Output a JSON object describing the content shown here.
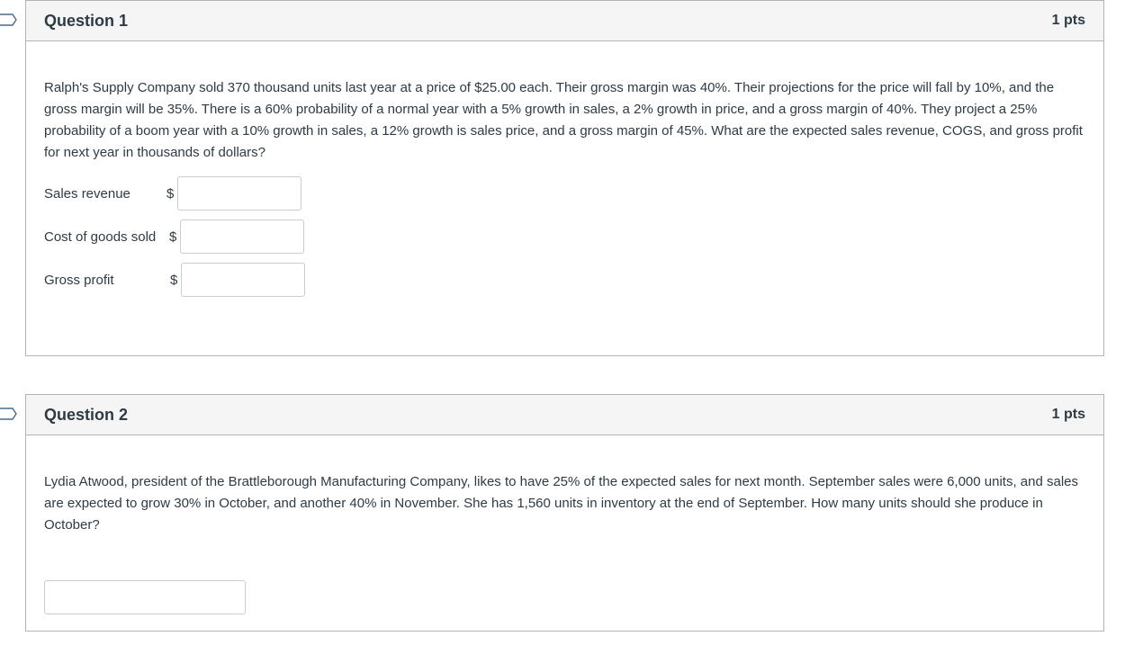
{
  "questions": [
    {
      "title": "Question 1",
      "points": "1 pts",
      "text": "Ralph's Supply Company sold 370 thousand units last year at a price of $25.00 each.  Their gross margin was 40%.  Their projections for the price will fall by 10%, and the gross margin will be 35%.  There is a 60% probability of a normal year with a 5% growth in sales, a 2% growth in price, and a gross margin of 40%.  They project a 25% probability of a boom year with a 10% growth in sales, a 12% growth is sales price, and a gross margin of 45%.  What are the expected sales revenue, COGS, and gross profit for next year in thousands of dollars?",
      "answers": [
        {
          "label": "Sales revenue",
          "currency": "$",
          "value": ""
        },
        {
          "label": "Cost of goods sold",
          "currency": "$",
          "value": ""
        },
        {
          "label": "Gross profit",
          "currency": "$",
          "value": ""
        }
      ]
    },
    {
      "title": "Question 2",
      "points": "1 pts",
      "text": "Lydia Atwood, president of the Brattleborough Manufacturing Company, likes to have 25% of the expected sales for next month.  September sales were 6,000 units, and sales are expected to grow 30% in October, and another 40% in November.  She has 1,560 units in inventory at the end of September.  How many units should she produce in October?",
      "answer_value": ""
    }
  ],
  "icons": {
    "bookmark": "bookmark-flag-icon"
  },
  "colors": {
    "header_bg": "#f5f5f5",
    "border": "#b4b4b4",
    "text": "#2d3b45",
    "bookmark_stroke": "#4a6c8a"
  }
}
